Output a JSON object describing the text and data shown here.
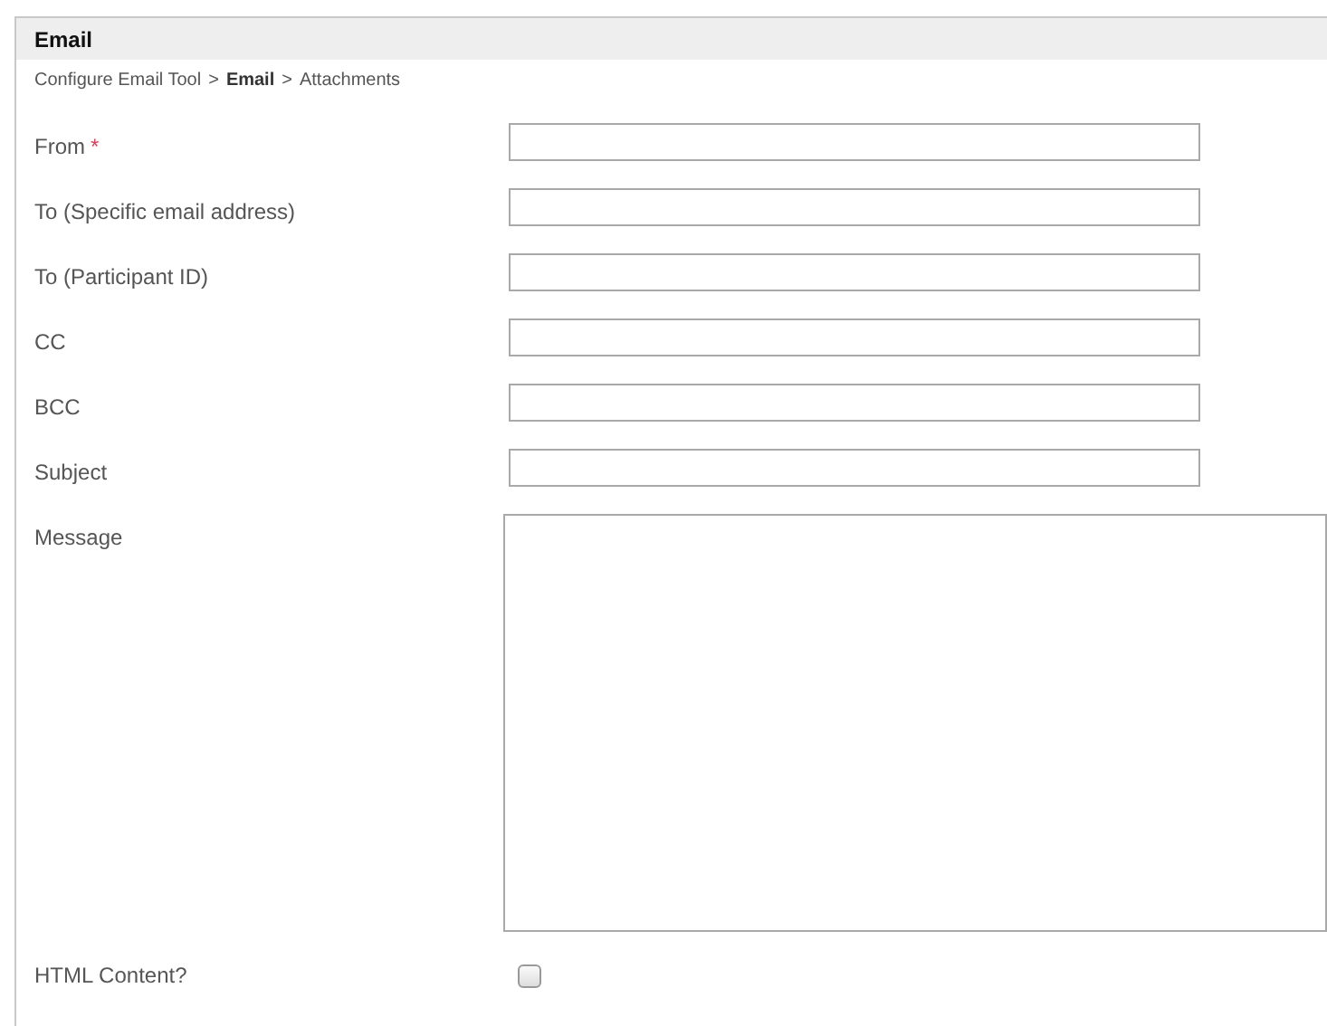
{
  "panel": {
    "title": "Email"
  },
  "breadcrumb": [
    {
      "label": "Configure Email Tool",
      "current": false
    },
    {
      "label": "Email",
      "current": true
    },
    {
      "label": "Attachments",
      "current": false
    }
  ],
  "breadcrumb_separator": ">",
  "fields": [
    {
      "label": "From",
      "required_mark": "*",
      "kind": "text"
    },
    {
      "label": "To (Specific email address)",
      "kind": "text"
    },
    {
      "label": "To (Participant ID)",
      "kind": "text"
    },
    {
      "label": "CC",
      "kind": "text"
    },
    {
      "label": "BCC",
      "kind": "text"
    },
    {
      "label": "Subject",
      "kind": "text"
    },
    {
      "label": "Message",
      "kind": "textarea"
    },
    {
      "label": "HTML Content?",
      "kind": "checkbox",
      "checked": false
    }
  ]
}
